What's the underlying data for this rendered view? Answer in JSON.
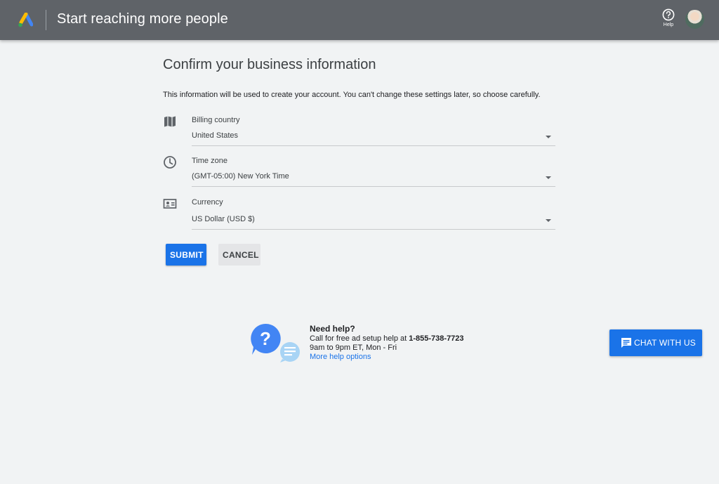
{
  "header": {
    "app_title": "Start reaching more people",
    "help_label": "Help",
    "logo_icon": "google-ads-logo",
    "help_icon": "help-circle-icon",
    "avatar_icon": "user-avatar"
  },
  "main": {
    "title": "Confirm your business information",
    "description": "This information will be used to create your account. You can't change these settings later, so choose carefully.",
    "fields": [
      {
        "label": "Billing country",
        "value": "United States",
        "icon": "map-icon"
      },
      {
        "label": "Time zone",
        "value": "(GMT-05:00) New York Time",
        "icon": "clock-icon"
      },
      {
        "label": "Currency",
        "value": "US Dollar (USD $)",
        "icon": "currency-card-icon"
      }
    ],
    "submit_label": "SUBMIT",
    "cancel_label": "CANCEL"
  },
  "help_section": {
    "title": "Need help?",
    "call_text": "Call for free ad setup help at ",
    "phone": "1-855-738-7723",
    "hours": "9am to 9pm ET, Mon - Fri",
    "more_link": "More help options"
  },
  "chat": {
    "label": "CHAT WITH US",
    "icon": "chat-icon"
  },
  "colors": {
    "accent": "#1a73e8",
    "header_bg": "#5f6368",
    "page_bg": "#f1f3f4"
  }
}
